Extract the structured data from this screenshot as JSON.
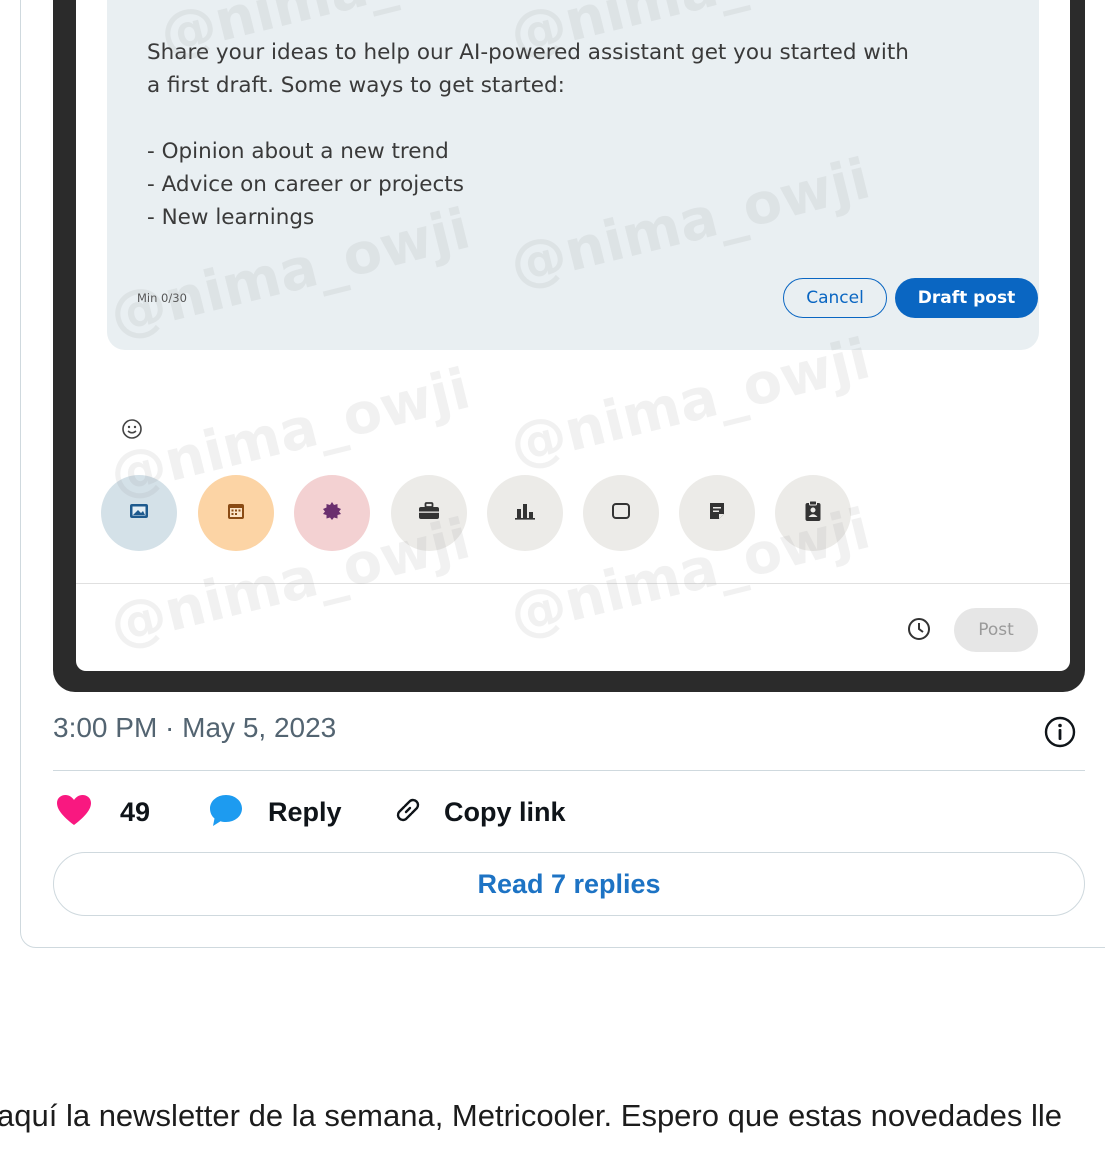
{
  "ai_prompt": {
    "text": "Share your ideas to help our AI-powered assistant get you started with\na first draft. Some ways to get started:\n\n- Opinion about a new trend\n- Advice on career or projects\n- New learnings",
    "min_count": "Min 0/30",
    "cancel_label": "Cancel",
    "draft_label": "Draft post"
  },
  "composer_tools": [
    {
      "icon": "image-icon",
      "bg": "#d4e1e8"
    },
    {
      "icon": "calendar-icon",
      "bg": "#fcd4a5"
    },
    {
      "icon": "celebrate-icon",
      "bg": "#f3d1d2"
    },
    {
      "icon": "briefcase-icon",
      "bg": "#ecebe8"
    },
    {
      "icon": "chart-icon",
      "bg": "#ecebe8"
    },
    {
      "icon": "template-icon",
      "bg": "#ecebe8"
    },
    {
      "icon": "document-icon",
      "bg": "#ecebe8"
    },
    {
      "icon": "clipboard-icon",
      "bg": "#ecebe8"
    }
  ],
  "post_label": "Post",
  "watermark": "@nima_owji",
  "tweet": {
    "timestamp": "3:00 PM · May 5, 2023",
    "likes": "49",
    "reply_label": "Reply",
    "copy_link_label": "Copy link",
    "read_replies_label": "Read 7 replies"
  },
  "article_text": "aquí la newsletter de la semana, Metricooler. Espero que estas novedades lle",
  "colors": {
    "linkedin_blue": "#0a66c2",
    "heart": "#f91880",
    "reply_bubble": "#1d9bf0",
    "read_link": "#1d73c4"
  }
}
